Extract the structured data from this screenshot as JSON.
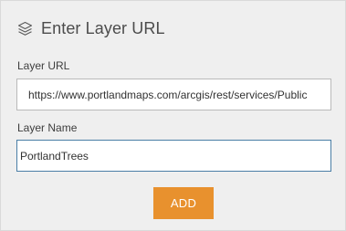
{
  "header": {
    "title": "Enter Layer URL",
    "icon": "layers-icon"
  },
  "form": {
    "url_label": "Layer URL",
    "url_value": "https://www.portlandmaps.com/arcgis/rest/services/Public",
    "name_label": "Layer Name",
    "name_value": "PortlandTrees",
    "add_label": "ADD"
  },
  "colors": {
    "panel_bg": "#efefef",
    "accent": "#e8912e",
    "focus_border": "#4a7ea6"
  }
}
